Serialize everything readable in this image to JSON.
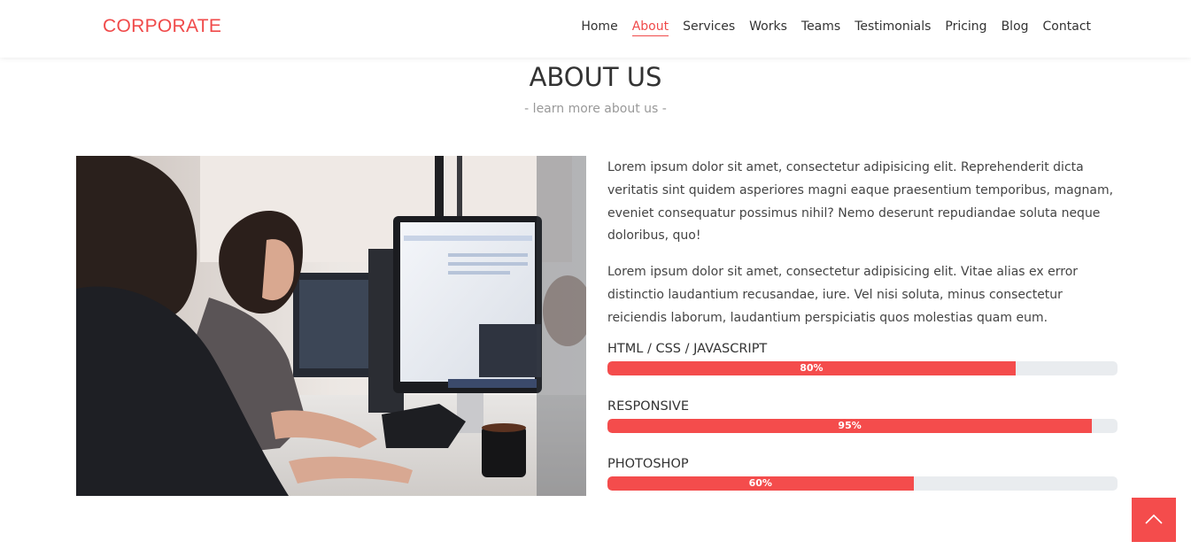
{
  "brand": "CORPORATE",
  "nav": {
    "items": [
      "Home",
      "About",
      "Services",
      "Works",
      "Teams",
      "Testimonials",
      "Pricing",
      "Blog",
      "Contact"
    ],
    "active": "About"
  },
  "section": {
    "title": "ABOUT US",
    "subtitle": "- learn more about us -"
  },
  "about": {
    "paragraphs": [
      "Lorem ipsum dolor sit amet, consectetur adipisicing elit. Reprehenderit dicta veritatis sint quidem asperiores magni eaque praesentium temporibus, magnam, eveniet consequatur possimus nihil? Nemo deserunt repudiandae soluta neque doloribus, quo!",
      "Lorem ipsum dolor sit amet, consectetur adipisicing elit. Vitae alias ex error distinctio laudantium recusandae, iure. Vel nisi soluta, minus consectetur reiciendis laborum, laudantium perspiciatis quos molestias quam eum."
    ],
    "skills": [
      {
        "label": "HTML / CSS / JAVASCRIPT",
        "percent": 80,
        "text": "80%"
      },
      {
        "label": "RESPONSIVE",
        "percent": 95,
        "text": "95%"
      },
      {
        "label": "PHOTOSHOP",
        "percent": 60,
        "text": "60%"
      }
    ]
  },
  "colors": {
    "accent": "#f44c4c",
    "brand": "#f04a4a",
    "track": "#e9ecef"
  },
  "icons": {
    "to_top": "chevron-up-icon"
  }
}
